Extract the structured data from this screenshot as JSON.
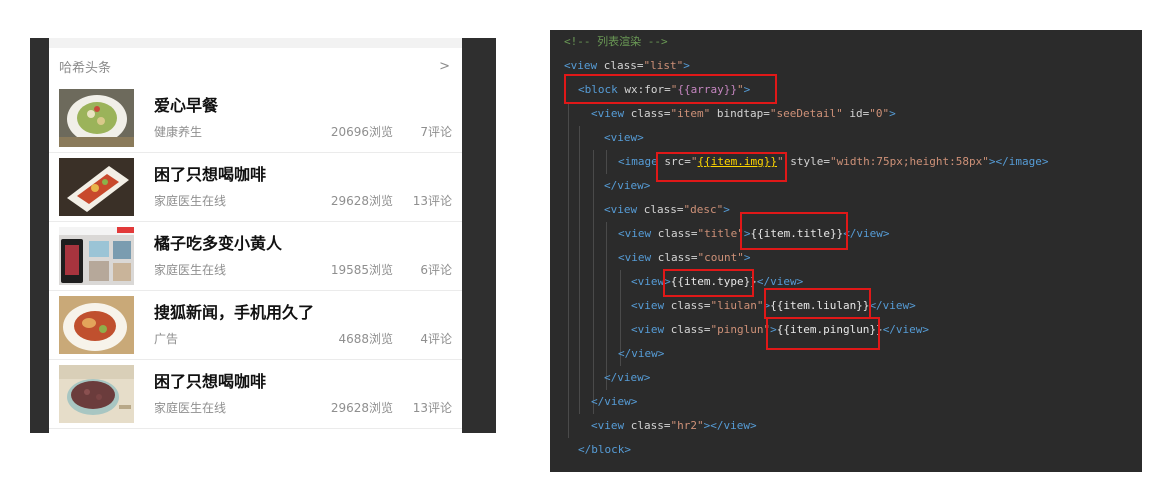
{
  "phone": {
    "header_title": "哈希头条",
    "header_arrow": ">",
    "items": [
      {
        "title": "爱心早餐",
        "type": "健康养生",
        "views": "20696浏览",
        "comments": "7评论"
      },
      {
        "title": "困了只想喝咖啡",
        "type": "家庭医生在线",
        "views": "29628浏览",
        "comments": "13评论"
      },
      {
        "title": "橘子吃多变小黄人",
        "type": "家庭医生在线",
        "views": "19585浏览",
        "comments": "6评论"
      },
      {
        "title": "搜狐新闻，手机用久了",
        "type": "广告",
        "views": "4688浏览",
        "comments": "4评论"
      },
      {
        "title": "困了只想喝咖啡",
        "type": "家庭医生在线",
        "views": "29628浏览",
        "comments": "13评论"
      }
    ]
  },
  "code": {
    "l0": "<!-- 列表渲染 -->",
    "l1_tag": "<view",
    "l1_attr": " class=",
    "l1_str": "\"list\"",
    "l1_end": ">",
    "l2_tag": "<block",
    "l2_attr": " wx:for=",
    "l2_q1": "\"",
    "l2_expr": "{{array}}",
    "l2_q2": "\"",
    "l2_end": ">",
    "l3_tag": "<view",
    "l3_attr1": " class=",
    "l3_str1": "\"item\"",
    "l3_attr2": " bindtap=",
    "l3_str2": "\"seeDetail\"",
    "l3_attr3": " id=",
    "l3_str3": "\"0\"",
    "l3_end": ">",
    "l4": "<view>",
    "l5_tag": "<image",
    "l5_attr1": " src=",
    "l5_q1": "\"",
    "l5_expr": "{{item.img}}",
    "l5_q2": "\"",
    "l5_attr2": " style=",
    "l5_str2": "\"width:75px;height:58px\"",
    "l5_end": "></image>",
    "l6": "</view>",
    "l7_tag": "<view",
    "l7_attr": " class=",
    "l7_str": "\"desc\"",
    "l7_end": ">",
    "l8_tag": "<view",
    "l8_attr": " class=",
    "l8_str": "\"title\"",
    "l8_gt": ">",
    "l8_expr": "{{item.title}}",
    "l8_end": "</view>",
    "l9_tag": "<view",
    "l9_attr": " class=",
    "l9_str": "\"count\"",
    "l9_end": ">",
    "l10_tag": "<view>",
    "l10_expr": "{{item.type}}",
    "l10_end": "</view>",
    "l11_tag": "<view",
    "l11_attr": " class=",
    "l11_str": "\"liulan\"",
    "l11_gt": ">",
    "l11_expr": "{{item.liulan}}",
    "l11_end": "</view>",
    "l12_tag": "<view",
    "l12_attr": " class=",
    "l12_str": "\"pinglun\"",
    "l12_gt": ">",
    "l12_expr": "{{item.pinglun}}",
    "l12_end": "</view>",
    "l13": "</view>",
    "l14": "</view>",
    "l15": "</view>",
    "l16_tag": "<view",
    "l16_attr": " class=",
    "l16_str": "\"hr2\"",
    "l16_end": "></view>",
    "l17": "</block>"
  },
  "colors": {
    "highlight": "#e01818",
    "code_bg": "#2b2b2b",
    "phone_frame": "#2f2f2f"
  },
  "icons": [
    "chevron-right-icon"
  ]
}
